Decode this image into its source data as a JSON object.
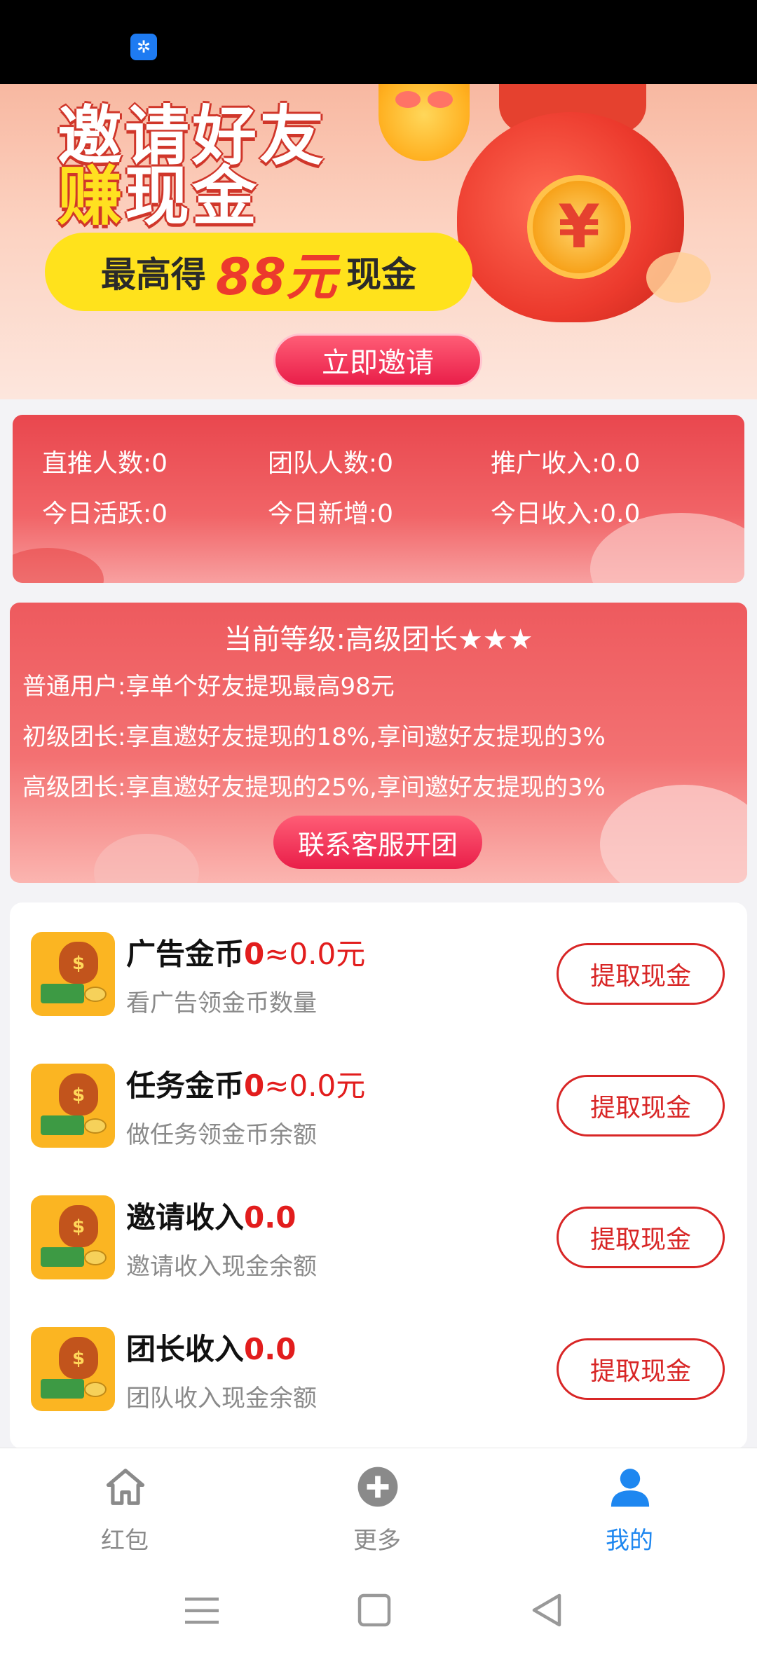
{
  "banner": {
    "title_line1": "邀请好友",
    "title_line2_a": "赚",
    "title_line2_b": "现金",
    "pill_prefix": "最高得",
    "pill_amount": "88元",
    "pill_suffix": "现金",
    "coin_symbol": "¥",
    "invite_button": "立即邀请"
  },
  "stats": {
    "direct": "直推人数:0",
    "team": "团队人数:0",
    "promo_income": "推广收入:0.0",
    "active_today": "今日活跃:0",
    "new_today": "今日新增:0",
    "income_today": "今日收入:0.0"
  },
  "level": {
    "title": "当前等级:高级团长★★★",
    "lines": [
      "普通用户:享单个好友提现最高98元",
      "初级团长:享直邀好友提现的18%,享间邀好友提现的3%",
      "高级团长:享直邀好友提现的25%,享间邀好友提现的3%"
    ],
    "contact_button": "联系客服开团"
  },
  "items": [
    {
      "title": "广告金币",
      "value_bold": "0",
      "value_rest": "≈0.0元",
      "subtitle": "看广告领金币数量",
      "button": "提取现金"
    },
    {
      "title": "任务金币",
      "value_bold": "0",
      "value_rest": "≈0.0元",
      "subtitle": "做任务领金币余额",
      "button": "提取现金"
    },
    {
      "title": "邀请收入",
      "value_bold": "0.0",
      "value_rest": "",
      "subtitle": "邀请收入现金余额",
      "button": "提取现金"
    },
    {
      "title": "团长收入",
      "value_bold": "0.0",
      "value_rest": "",
      "subtitle": "团队收入现金余额",
      "button": "提取现金"
    }
  ],
  "tabs": [
    {
      "label": "红包",
      "icon": "home-icon",
      "active": false
    },
    {
      "label": "更多",
      "icon": "plus-circle-icon",
      "active": false
    },
    {
      "label": "我的",
      "icon": "user-icon",
      "active": true
    }
  ],
  "colors": {
    "accent_red": "#e21d1d",
    "tab_active": "#1e87f0",
    "tab_inactive": "#8a8a8a"
  }
}
